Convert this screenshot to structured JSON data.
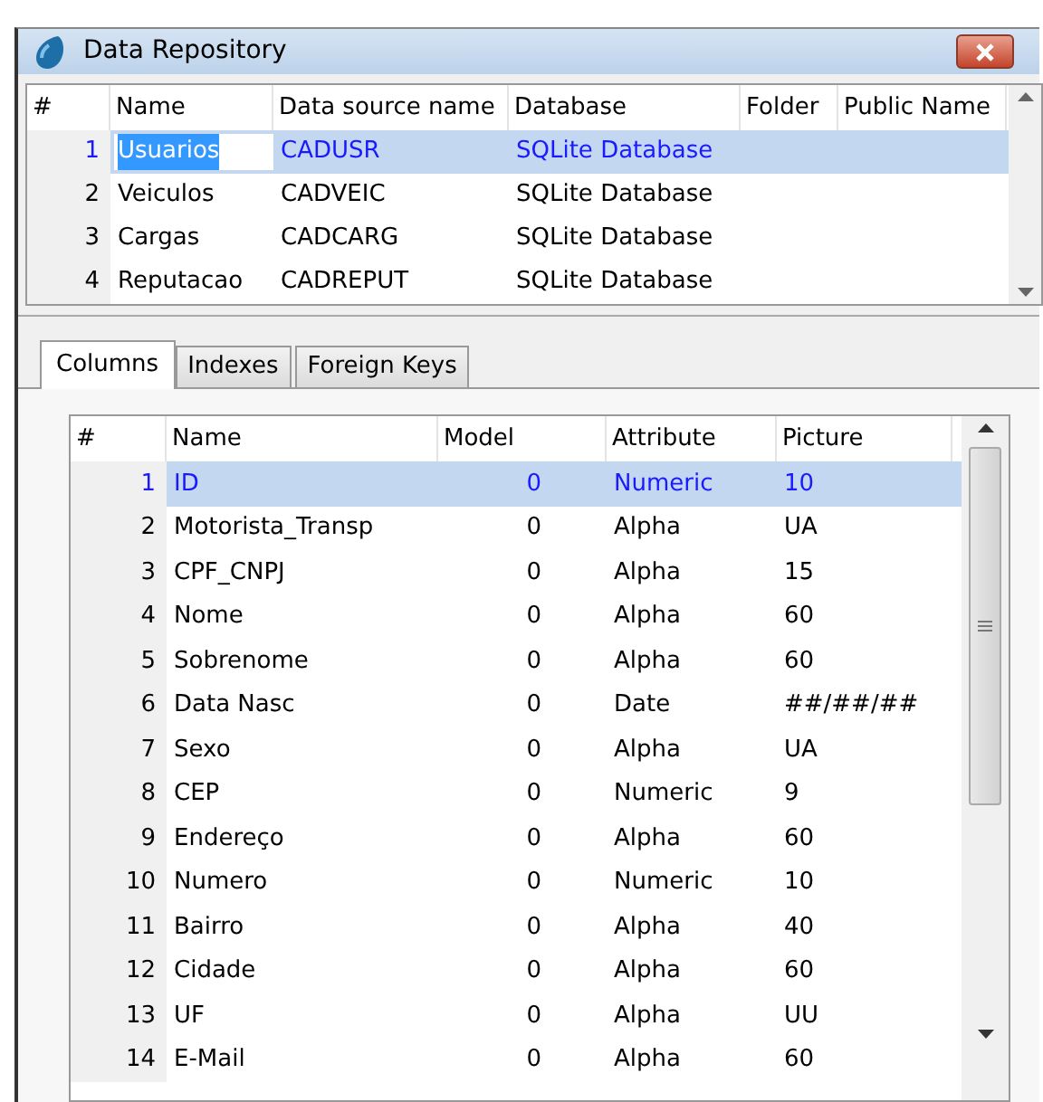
{
  "window": {
    "title": "Data Repository"
  },
  "sources": {
    "columns": [
      "#",
      "Name",
      "Data source name",
      "Database",
      "Folder",
      "Public Name"
    ],
    "rows": [
      {
        "cells": [
          "1",
          "Usuarios",
          "CADUSR",
          "SQLite Database"
        ],
        "selected": true,
        "editing": true
      },
      {
        "cells": [
          "2",
          "Veiculos",
          "CADVEIC",
          "SQLite Database"
        ],
        "selected": false,
        "editing": false
      },
      {
        "cells": [
          "3",
          "Cargas",
          "CADCARG",
          "SQLite Database"
        ],
        "selected": false,
        "editing": false
      },
      {
        "cells": [
          "4",
          "Reputacao",
          "CADREPUT",
          "SQLite Database"
        ],
        "selected": false,
        "editing": false
      }
    ]
  },
  "tabs": [
    {
      "label": "Columns",
      "selected": true
    },
    {
      "label": "Indexes",
      "selected": false
    },
    {
      "label": "Foreign Keys",
      "selected": false
    }
  ],
  "fields": {
    "columns": [
      "#",
      "Name",
      "Model",
      "Attribute",
      "Picture"
    ],
    "rows": [
      {
        "cells": [
          "1",
          "ID",
          "0",
          "Numeric",
          "10"
        ],
        "selected": true
      },
      {
        "cells": [
          "2",
          "Motorista_Transp",
          "0",
          "Alpha",
          "UA"
        ],
        "selected": false
      },
      {
        "cells": [
          "3",
          "CPF_CNPJ",
          "0",
          "Alpha",
          "15"
        ],
        "selected": false
      },
      {
        "cells": [
          "4",
          "Nome",
          "0",
          "Alpha",
          "60"
        ],
        "selected": false
      },
      {
        "cells": [
          "5",
          "Sobrenome",
          "0",
          "Alpha",
          "60"
        ],
        "selected": false
      },
      {
        "cells": [
          "6",
          "Data Nasc",
          "0",
          "Date",
          "##/##/##"
        ],
        "selected": false
      },
      {
        "cells": [
          "7",
          "Sexo",
          "0",
          "Alpha",
          "UA"
        ],
        "selected": false
      },
      {
        "cells": [
          "8",
          "CEP",
          "0",
          "Numeric",
          "9"
        ],
        "selected": false
      },
      {
        "cells": [
          "9",
          "Endereço",
          "0",
          "Alpha",
          "60"
        ],
        "selected": false
      },
      {
        "cells": [
          "10",
          "Numero",
          "0",
          "Numeric",
          "10"
        ],
        "selected": false
      },
      {
        "cells": [
          "11",
          "Bairro",
          "0",
          "Alpha",
          "40"
        ],
        "selected": false
      },
      {
        "cells": [
          "12",
          "Cidade",
          "0",
          "Alpha",
          "60"
        ],
        "selected": false
      },
      {
        "cells": [
          "13",
          "UF",
          "0",
          "Alpha",
          "UU"
        ],
        "selected": false
      },
      {
        "cells": [
          "14",
          "E-Mail",
          "0",
          "Alpha",
          "60"
        ],
        "selected": false
      }
    ]
  }
}
